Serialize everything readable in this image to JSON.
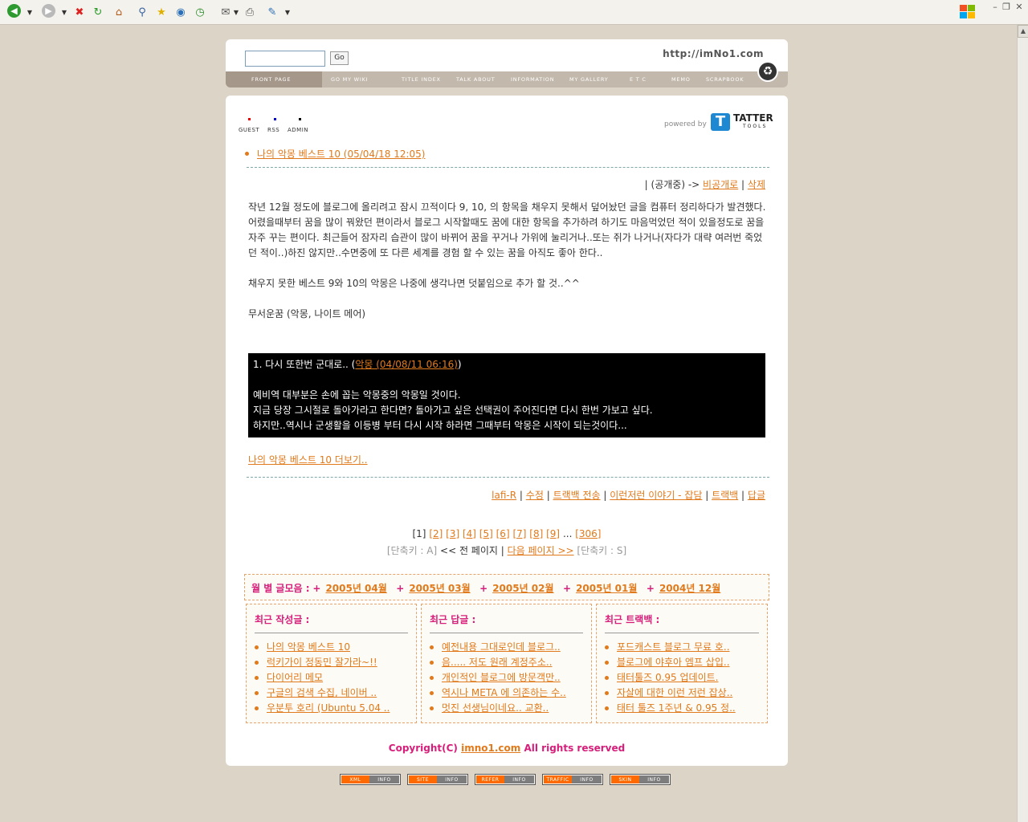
{
  "browser": {
    "toolbar_icons": [
      "back-icon",
      "forward-icon",
      "stop-icon",
      "refresh-icon",
      "home-icon",
      "search-icon",
      "favorites-icon",
      "media-icon",
      "history-icon",
      "mail-icon",
      "print-icon",
      "edit-icon"
    ]
  },
  "header": {
    "search_placeholder": "",
    "go_label": "Go",
    "site_url": "http://imNo1.com",
    "nav": [
      "FRONT PAGE",
      "GO MY WIKI",
      "TITLE INDEX",
      "TALK ABOUT",
      "INFORMATION",
      "MY GALLERY",
      "E T C",
      "MEMO",
      "SCRAPBOOK"
    ]
  },
  "icons": {
    "guest": "GUEST",
    "rss": "RSS",
    "admin": "ADMIN"
  },
  "powered": {
    "label": "powered by",
    "brand": "TATTER",
    "sub": "TOOLS"
  },
  "post": {
    "title": "나의 악몽 베스트 10 (05/04/18 12:05)",
    "status_prefix": "| (공개중) ->",
    "make_private": "비공개로",
    "delete": "삭제",
    "paragraphs": [
      "작년 12월 정도에 블로그에 올리려고 잠시 끄적이다 9, 10, 의 항목을 채우지 못해서 덮어놨던 글을 컴퓨터 정리하다가 발견했다.",
      "어렸을때부터 꿈을 많이 꿔왔던 편이라서 블로그 시작할때도 꿈에 대한 항목을 추가하려 하기도 마음먹었던 적이 있을정도로 꿈을 자주 꾸는 편이다. 최근들어 잠자리 습관이 많이 바뀌어 꿈을 꾸거나 가위에 눌리거나..또는 쥐가 나거나(자다가 대략 여러번 죽었던 적이..)하진 않지만..수면중에 또 다른 세계를 경험 할 수 있는 꿈을 아직도 좋아 한다..",
      "",
      "채우지 못한 베스트 9와 10의 악몽은 나중에 생각나면 덧붙임으로 추가 할 것..^^",
      "",
      "무서운꿈 (악몽, 나이트 메어)"
    ],
    "quote_heading": "1. 다시 또한번 군대로.. (",
    "quote_link": "악몽 (04/08/11 06:16)",
    "quote_close": ")",
    "quote_lines": [
      "예비역 대부분은 손에 꼽는 악몽중의 악몽일 것이다.",
      "지금 당장 그시절로 돌아가라고 한다면? 돌아가고 싶은 선택권이 주어진다면 다시 한번 가보고 싶다.",
      "하지만..역시나 군생활을 이등병 부터 다시 시작 하라면 그때부터 악몽은 시작이 되는것이다..."
    ],
    "more": "나의 악몽 베스트 10 더보기..",
    "meta": {
      "author": "lafi-R",
      "edit": "수정",
      "trackback_send": "트랙백 전송",
      "category": "이런저런 이야기 - 잡담",
      "trackback": "트랙백",
      "reply": "답글"
    }
  },
  "pager": {
    "current": "[1]",
    "pages": [
      "[2]",
      "[3]",
      "[4]",
      "[5]",
      "[6]",
      "[7]",
      "[8]",
      "[9]"
    ],
    "ellipsis": "...",
    "last": "[306]",
    "shortcut_prev": "[단축키 : A]",
    "prev": "<< 전 페이지",
    "next": "다음 페이지 >>",
    "shortcut_next": "[단축키 : S]"
  },
  "archive": {
    "label": "월 별 글모음 :",
    "items": [
      "2005년 04월",
      "2005년 03월",
      "2005년 02월",
      "2005년 01월",
      "2004년 12월"
    ]
  },
  "recent_posts": {
    "title": "최근 작성글 :",
    "items": [
      "나의 악몽 베스트 10",
      "럭키가이 정동민 잘가라~!!",
      "다이어리 메모",
      "구글의 검색 수집, 네이버 ..",
      "우분투 호리 (Ubuntu 5.04 .."
    ]
  },
  "recent_replies": {
    "title": "최근 답글 :",
    "items": [
      "예전내용 그대로인데 블로그..",
      "음..... 저도 원래 계정주소..",
      "개인적인 블로그에 방문객만..",
      "역시나 META 에 의존하는 수..",
      "멋진 선생님이네요.. 교환.."
    ]
  },
  "recent_trackbacks": {
    "title": "최근 트랙백 :",
    "items": [
      "포드캐스트 블로그 무료 호..",
      "블로그에 야후아 엠프 삽입..",
      "태터툴즈 0.95 업데이트.",
      "자살에 대한 이런 저런 잡상..",
      "태터 툴즈 1주년 & 0.95 정.."
    ]
  },
  "copyright": {
    "prefix": "Copyright(C)",
    "link": "imno1.com",
    "suffix": "All rights reserved"
  },
  "badges": [
    {
      "left": "XML",
      "right": "INFO"
    },
    {
      "left": "SITE",
      "right": "INFO"
    },
    {
      "left": "REFER",
      "right": "INFO"
    },
    {
      "left": "TRAFFIC",
      "right": "INFO"
    },
    {
      "left": "SKIN",
      "right": "INFO"
    }
  ],
  "colors": {
    "accent": "#e07a1c",
    "pink": "#d61e7a",
    "background": "#ddd4c8",
    "nav": "#c2b8ac"
  }
}
